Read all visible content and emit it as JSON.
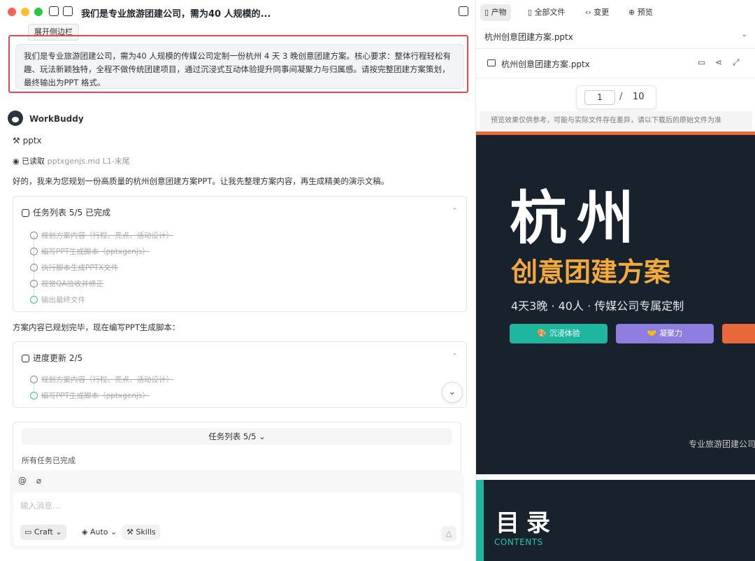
{
  "window": {
    "title": "我们是专业旅游团建公司，需为40 人规模的...",
    "tooltip": "展开侧边栏"
  },
  "chat": {
    "user_prompt": "我们是专业旅游团建公司，需为40 人规模的传媒公司定制一份杭州 4 天 3 晚创意团建方案。核心要求：整体行程轻松有趣、玩法新颖独特，全程不做传统团建项目，通过沉浸式互动体验提升同事间凝聚力与归属感。请按完整团建方案策划，最终输出为PPT 格式。",
    "bot_name": "WorkBuddy",
    "skill_label": "pptx",
    "read_label": "已读取",
    "read_file": "pptxgenjs.md",
    "read_range": "L1-末尾",
    "intro_text": "好的，我来为您规划一份高质量的杭州创意团建方案PPT。让我先整理方案内容，再生成精美的演示文稿。",
    "task_card": {
      "title": "任务列表 5/5 已完成",
      "items": [
        "规划方案内容（行程、亮点、活动设计）",
        "编写PPT生成脚本（pptxgenjs）",
        "执行脚本生成PPTX文件",
        "视觉QA验收并修正",
        "输出最终文件"
      ]
    },
    "mid_text": "方案内容已规划完毕，现在编写PPT生成脚本：",
    "progress_card": {
      "title": "进度更新 2/5",
      "items": [
        "规划方案内容（行程、亮点、活动设计）",
        "编写PPT生成脚本（pptxgenjs）"
      ]
    },
    "summary": {
      "bar_label": "任务列表 5/5",
      "text": "所有任务已完成"
    }
  },
  "composer": {
    "at_icon": "@",
    "placeholder": "输入消息...",
    "mode_label": "Craft",
    "model_label": "Auto",
    "skills_label": "Skills"
  },
  "preview": {
    "tabs": [
      "产物",
      "全部文件",
      "变更",
      "预览"
    ],
    "file_select": "杭州创意团建方案.pptx",
    "file_name": "杭州创意团建方案.pptx",
    "page_current": "1",
    "page_sep": "/",
    "page_total": "10",
    "notice": "预览效果仅供参考，可能与实际文件存在差异，请以下载后的原始文件为准",
    "slide1": {
      "title": "杭州",
      "subtitle": "创意团建方案",
      "desc": "4天3晚 · 40人 · 传媒公司专属定制",
      "chips": [
        "🎨 沉浸体验",
        "🤝 凝聚力",
        "✨"
      ],
      "chip_colors": [
        "#1fb6a0",
        "#8d7ee0",
        "#e8683a"
      ],
      "footer": "专业旅游团建公司"
    },
    "slide2": {
      "title": "目录",
      "subtitle": "CONTENTS"
    }
  }
}
